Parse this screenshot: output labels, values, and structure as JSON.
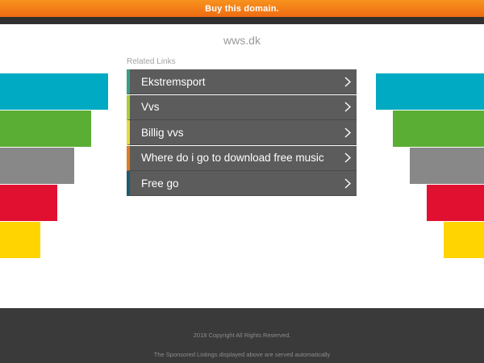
{
  "topbar": {
    "label": "Buy this domain."
  },
  "domain": {
    "title": "wws.dk"
  },
  "related": {
    "heading": "Related Links",
    "links": [
      {
        "label": "Ekstremsport",
        "accent": "#3a9e86"
      },
      {
        "label": "Vvs",
        "accent": "#a8cf3a"
      },
      {
        "label": "Billig vvs",
        "accent": "#e7d93f"
      },
      {
        "label": "Where do i go to download free music",
        "accent": "#e07b22"
      },
      {
        "label": "Free go",
        "accent": "#1e5a73"
      }
    ]
  },
  "stripes": {
    "colors": [
      "#00aac2",
      "#5aae33",
      "#888888",
      "#e11031",
      "#ffd400"
    ]
  },
  "footer": {
    "copyright": "2018 Copyright All Rights Reserved.",
    "disclaimer": "The Sponsored Listings displayed above are served automatically"
  }
}
